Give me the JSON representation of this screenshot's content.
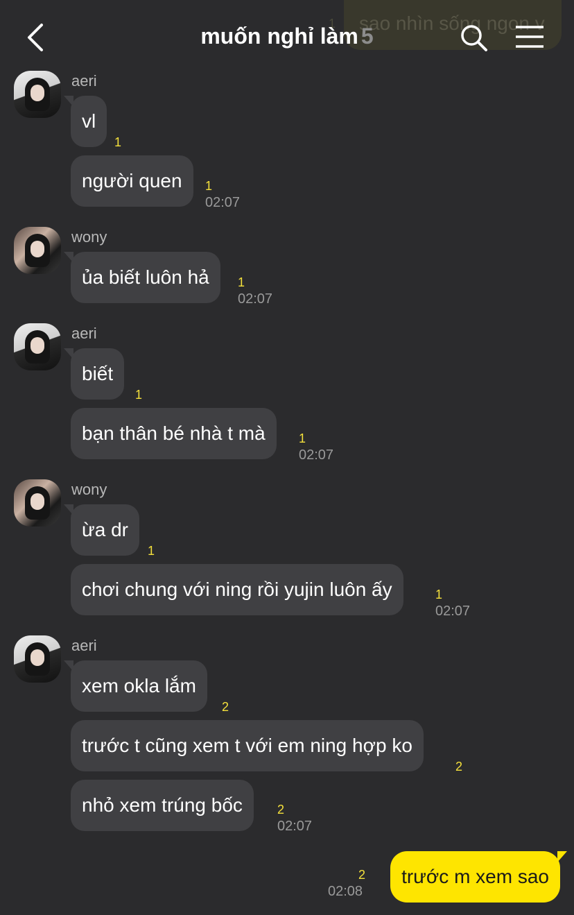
{
  "header": {
    "title": "muốn nghỉ làm",
    "member_count": "5"
  },
  "ghost_message": {
    "text": "sao nhìn sống ngon v",
    "read": "1"
  },
  "groups": [
    {
      "sender": "aeri",
      "messages": [
        {
          "text": "vl",
          "read": "1"
        },
        {
          "text": "người quen",
          "read": "1",
          "time": "02:07"
        }
      ]
    },
    {
      "sender": "wony",
      "messages": [
        {
          "text": "ủa biết luôn hả",
          "read": "1",
          "time": "02:07"
        }
      ]
    },
    {
      "sender": "aeri",
      "messages": [
        {
          "text": "biết",
          "read": "1"
        },
        {
          "text": "bạn thân bé nhà t mà",
          "read": "1",
          "time": "02:07"
        }
      ]
    },
    {
      "sender": "wony",
      "messages": [
        {
          "text": "ừa dr",
          "read": "1"
        },
        {
          "text": "chơi chung với ning rồi yujin luôn ấy",
          "read": "1",
          "time": "02:07"
        }
      ]
    },
    {
      "sender": "aeri",
      "messages": [
        {
          "text": "xem okla lắm",
          "read": "2"
        },
        {
          "text": "trước t cũng xem t với em ning hợp ko",
          "read": "2"
        },
        {
          "text": "nhỏ xem trúng bốc",
          "read": "2",
          "time": "02:07"
        }
      ]
    }
  ],
  "my_message": {
    "text": "trước m xem sao",
    "read": "2",
    "time": "02:08"
  },
  "colors": {
    "background": "#2b2b2d",
    "bubble_other": "#404043",
    "bubble_mine": "#fee500",
    "unread_count": "#f5e13c"
  },
  "icons": [
    "back-arrow-icon",
    "search-icon",
    "menu-icon"
  ]
}
